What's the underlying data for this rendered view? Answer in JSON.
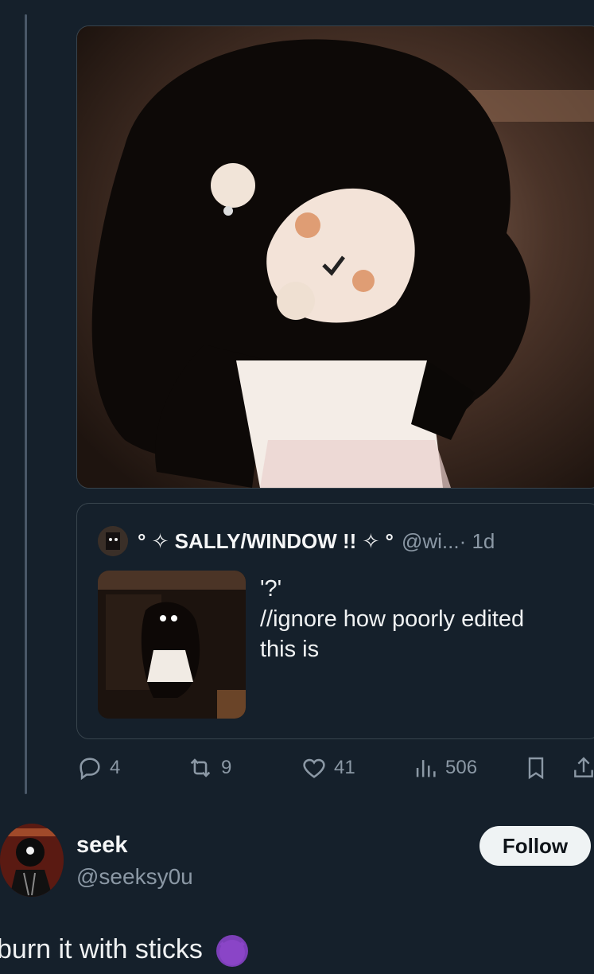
{
  "quoted_tweet": {
    "display_name": "° ✧ SALLY/WINDOW !! ✧ °",
    "handle": "@wi...",
    "time": " · 1d",
    "text_lines": [
      "'?'",
      "//ignore how poorly edited",
      "this is"
    ]
  },
  "actions": {
    "replies": "4",
    "reposts": "9",
    "likes": "41",
    "views": "506"
  },
  "icons": {
    "reply": "reply-icon",
    "repost": "repost-icon",
    "like": "heart-icon",
    "views": "analytics-icon",
    "bookmark": "bookmark-icon",
    "share": "share-icon"
  },
  "user": {
    "display_name": "seek",
    "handle": "@seeksy0u",
    "follow_label": "Follow"
  },
  "next_tweet": {
    "text": "burn it with sticks"
  },
  "colors": {
    "background": "#15202b",
    "border": "#38444d",
    "muted": "#8b98a5",
    "follow_bg": "#eff3f4"
  }
}
